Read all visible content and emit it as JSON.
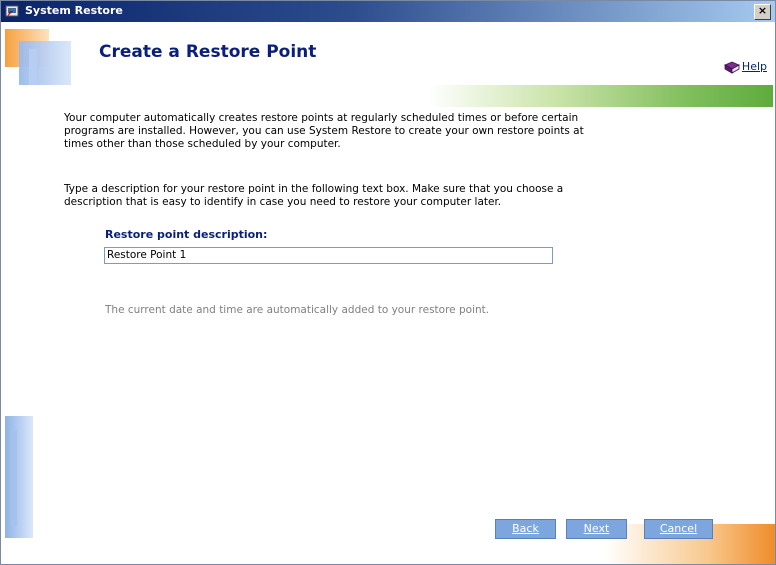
{
  "window": {
    "title": "System Restore",
    "close_label": "×"
  },
  "header": {
    "title": "Create a Restore Point",
    "help_label": "Help"
  },
  "content": {
    "paragraph1": "Your computer automatically creates restore points at regularly scheduled times or before certain programs are installed. However, you can use System Restore to create your own restore points at times other than those scheduled by your computer.",
    "paragraph2": "Type a description for your restore point in the following text box. Make sure that you choose a description that is easy to identify in case you need to restore your computer later.",
    "field_label": "Restore point description:",
    "field_value": "Restore Point 1",
    "hint": "The current date and time are automatically added to your restore point."
  },
  "buttons": {
    "back": "Back",
    "next": "Next",
    "cancel": "Cancel"
  },
  "colors": {
    "title_blue": "#0a1f7a",
    "titlebar": "#0a246a",
    "button": "#7ea6de",
    "green_band": "#5eab3c",
    "orange_corner": "#ef8c2a"
  }
}
